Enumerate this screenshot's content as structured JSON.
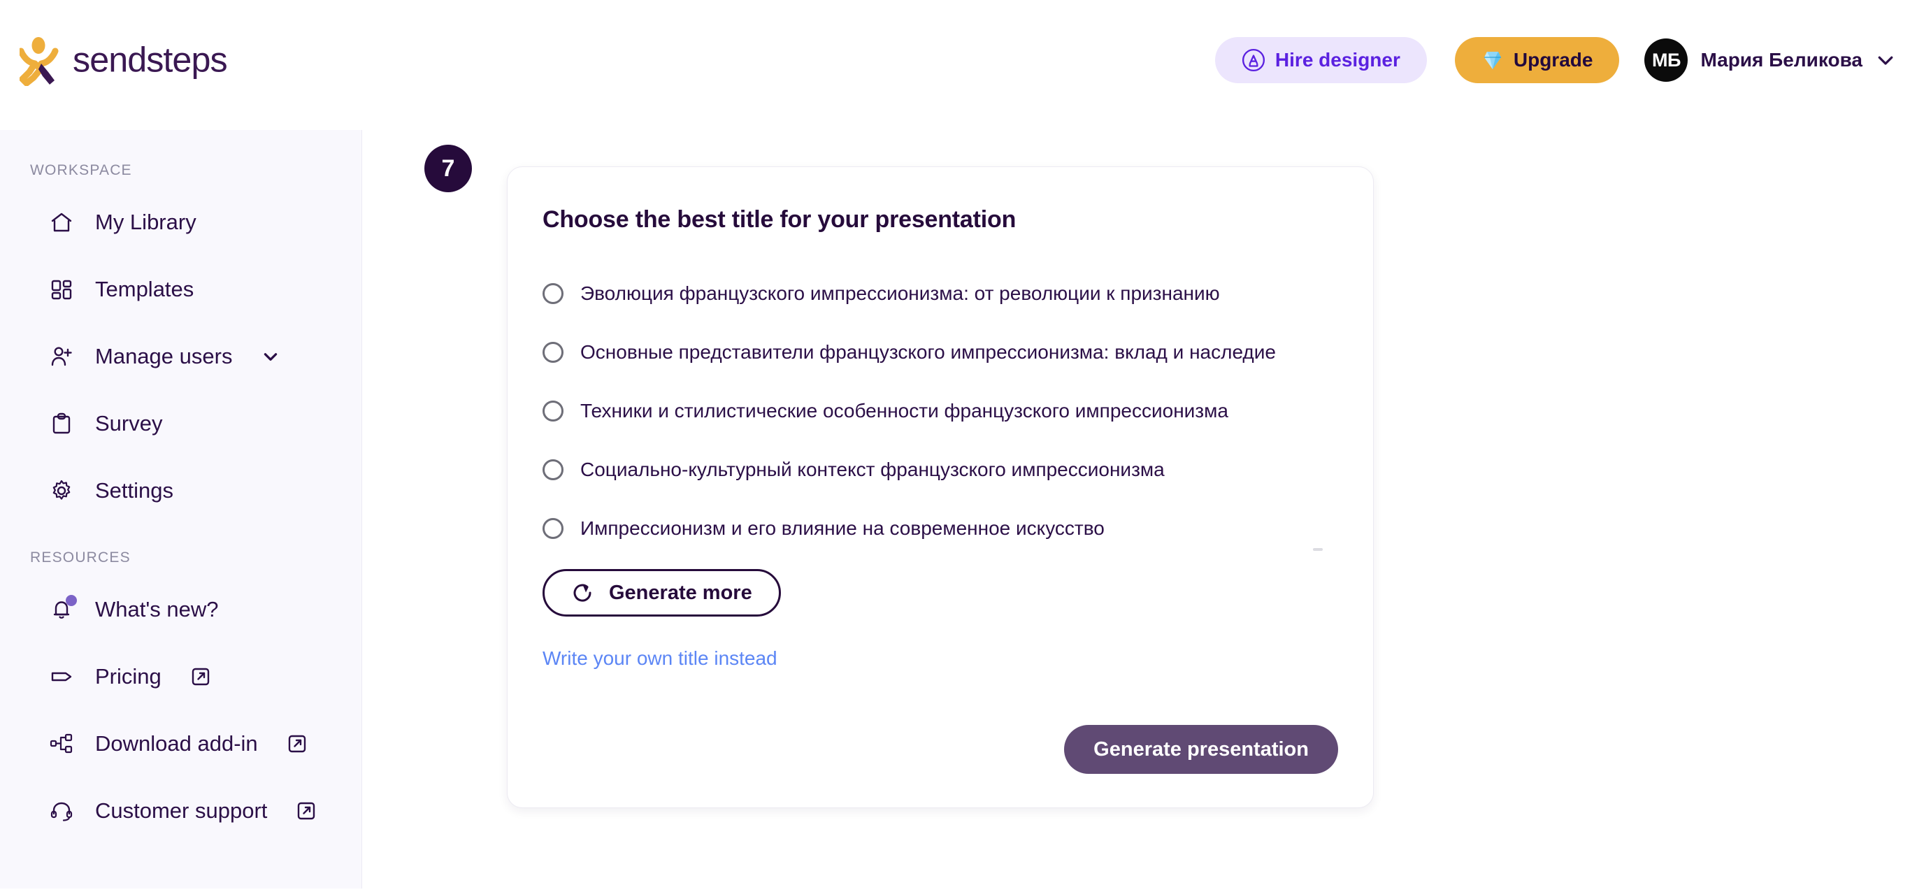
{
  "header": {
    "logo_text": "sendsteps",
    "hire_designer_label": "Hire designer",
    "upgrade_label": "Upgrade",
    "user_initials": "МБ",
    "user_name": "Мария Беликова",
    "hire_icon": "designer-circle-a-icon",
    "upgrade_icon": "gem-icon",
    "chevron_icon": "chevron-down-icon",
    "accent_purple": "#5b21e0",
    "accent_yellow": "#eeae3c",
    "brand_dark": "#2b0f47"
  },
  "sidebar": {
    "workspace_label": "WORKSPACE",
    "resources_label": "RESOURCES",
    "workspace_items": [
      {
        "label": "My Library",
        "icon": "home-icon",
        "chevron": false,
        "external": false
      },
      {
        "label": "Templates",
        "icon": "layout-grid-icon",
        "chevron": false,
        "external": false
      },
      {
        "label": "Manage users",
        "icon": "user-plus-icon",
        "chevron": true,
        "external": false
      },
      {
        "label": "Survey",
        "icon": "clipboard-icon",
        "chevron": false,
        "external": false
      },
      {
        "label": "Settings",
        "icon": "gear-icon",
        "chevron": false,
        "external": false
      }
    ],
    "resources_items": [
      {
        "label": "What's new?",
        "icon": "bell-icon",
        "badge_dot": true,
        "external": false
      },
      {
        "label": "Pricing",
        "icon": "tag-icon",
        "badge_dot": false,
        "external": true
      },
      {
        "label": "Download add-in",
        "icon": "plugin-icon",
        "badge_dot": false,
        "external": true
      },
      {
        "label": "Customer support",
        "icon": "headset-icon",
        "badge_dot": false,
        "external": true
      }
    ],
    "background": "#f9f8fd"
  },
  "main": {
    "step_number": "7",
    "card_title": "Choose the best title for your presentation",
    "options": [
      {
        "label": "Эволюция французского импрессионизма: от революции к признанию",
        "selected": false
      },
      {
        "label": "Основные представители французского импрессионизма: вклад и наследие",
        "selected": false
      },
      {
        "label": "Техники и стилистические особенности французского импрессионизма",
        "selected": false
      },
      {
        "label": "Социально-культурный контекст французского импрессионизма",
        "selected": false
      },
      {
        "label": "Импрессионизм и его влияние на современное искусство",
        "selected": false
      }
    ],
    "generate_more_label": "Generate more",
    "generate_more_icon": "refresh-icon",
    "write_own_title_label": "Write your own title instead",
    "generate_presentation_label": "Generate presentation",
    "primary_button_color": "#604a74",
    "link_color": "#5c86f5"
  }
}
